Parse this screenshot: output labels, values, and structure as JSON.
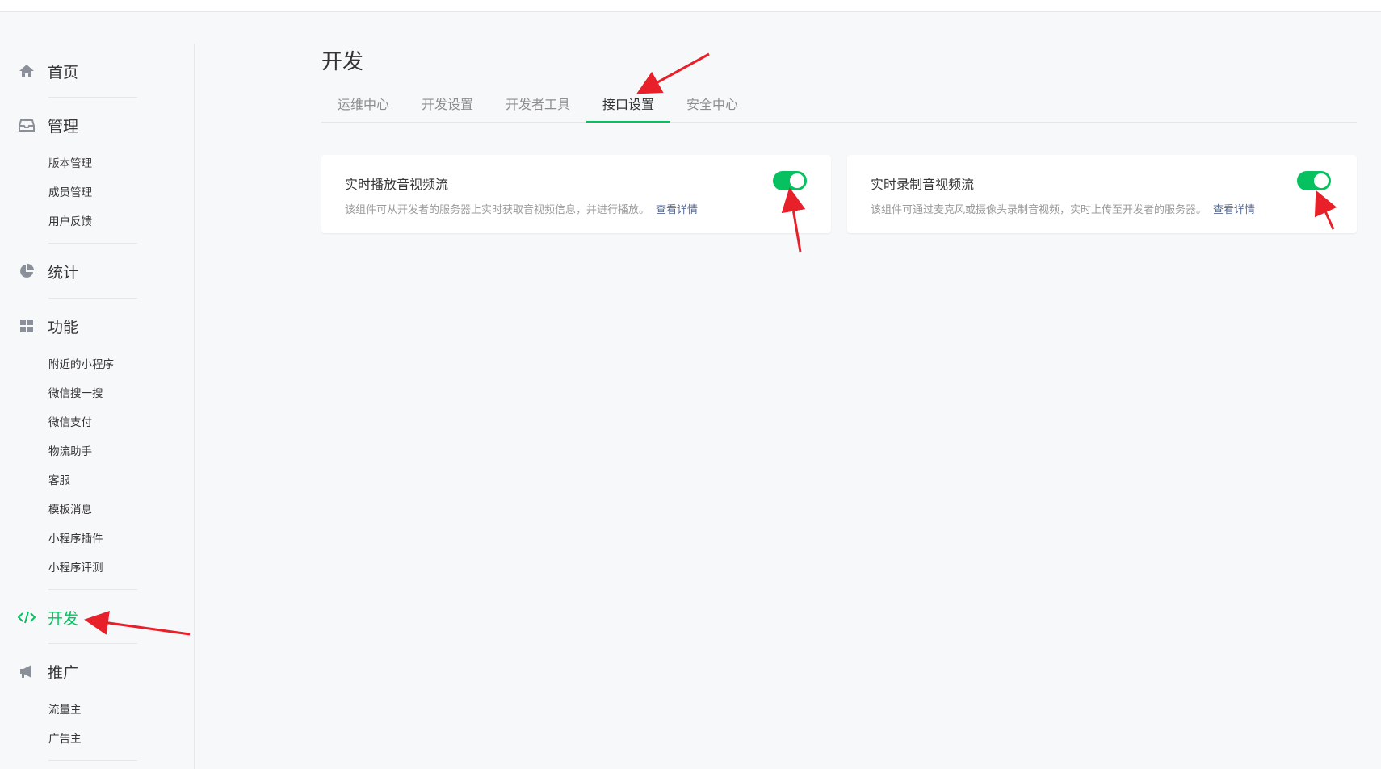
{
  "sidebar": {
    "home": "首页",
    "manage": {
      "label": "管理",
      "items": [
        "版本管理",
        "成员管理",
        "用户反馈"
      ]
    },
    "stats": "统计",
    "features": {
      "label": "功能",
      "items": [
        "附近的小程序",
        "微信搜一搜",
        "微信支付",
        "物流助手",
        "客服",
        "模板消息",
        "小程序插件",
        "小程序评测"
      ]
    },
    "develop": "开发",
    "promote": {
      "label": "推广",
      "items": [
        "流量主",
        "广告主"
      ]
    }
  },
  "page": {
    "title": "开发",
    "tabs": [
      "运维中心",
      "开发设置",
      "开发者工具",
      "接口设置",
      "安全中心"
    ],
    "active_tab": "接口设置"
  },
  "cards": [
    {
      "title": "实时播放音视频流",
      "desc": "该组件可从开发者的服务器上实时获取音视频信息，并进行播放。",
      "link": "查看详情",
      "enabled": true
    },
    {
      "title": "实时录制音视频流",
      "desc": "该组件可通过麦克风或摄像头录制音视频，实时上传至开发者的服务器。",
      "link": "查看详情",
      "enabled": true
    }
  ],
  "colors": {
    "accent": "#07c160",
    "link": "#576b95",
    "annotation": "#e8202a"
  }
}
